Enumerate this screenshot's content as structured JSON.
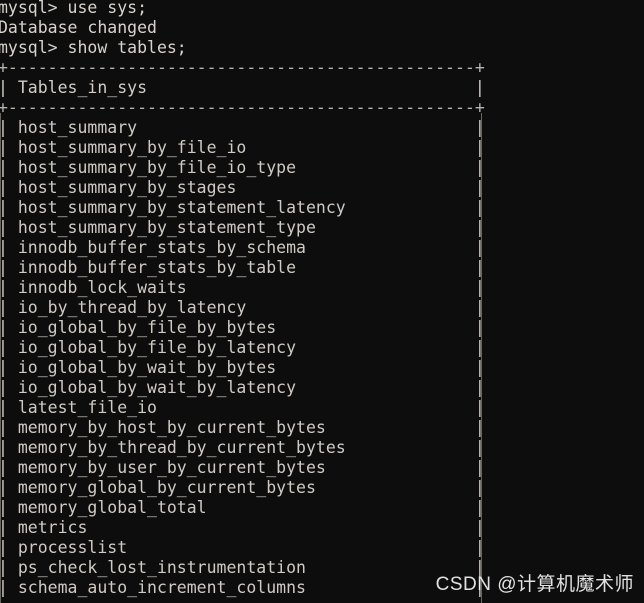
{
  "terminal": {
    "background_color": "#0d0d0d",
    "text_color": "#d4cfc9",
    "border_color": "#6a665f",
    "lines": [
      "mysql> use sys;",
      "Database changed",
      "mysql> show tables;"
    ],
    "prompt": "mysql>",
    "commands": [
      "use sys;",
      "show tables;"
    ],
    "status_message": "Database changed"
  },
  "result_table": {
    "top_rule": "+-----------------------------------------------+",
    "header_row": "| Tables_in_sys                                 |",
    "header_rule": "+-----------------------------------------------+",
    "column_header": "Tables_in_sys",
    "rows": [
      "host_summary",
      "host_summary_by_file_io",
      "host_summary_by_file_io_type",
      "host_summary_by_stages",
      "host_summary_by_statement_latency",
      "host_summary_by_statement_type",
      "innodb_buffer_stats_by_schema",
      "innodb_buffer_stats_by_table",
      "innodb_lock_waits",
      "io_by_thread_by_latency",
      "io_global_by_file_by_bytes",
      "io_global_by_file_by_latency",
      "io_global_by_wait_by_bytes",
      "io_global_by_wait_by_latency",
      "latest_file_io",
      "memory_by_host_by_current_bytes",
      "memory_by_thread_by_current_bytes",
      "memory_by_user_by_current_bytes",
      "memory_global_by_current_bytes",
      "memory_global_total",
      "metrics",
      "processlist",
      "ps_check_lost_instrumentation",
      "schema_auto_increment_columns"
    ]
  },
  "watermark": {
    "text": "CSDN @计算机魔术师"
  }
}
